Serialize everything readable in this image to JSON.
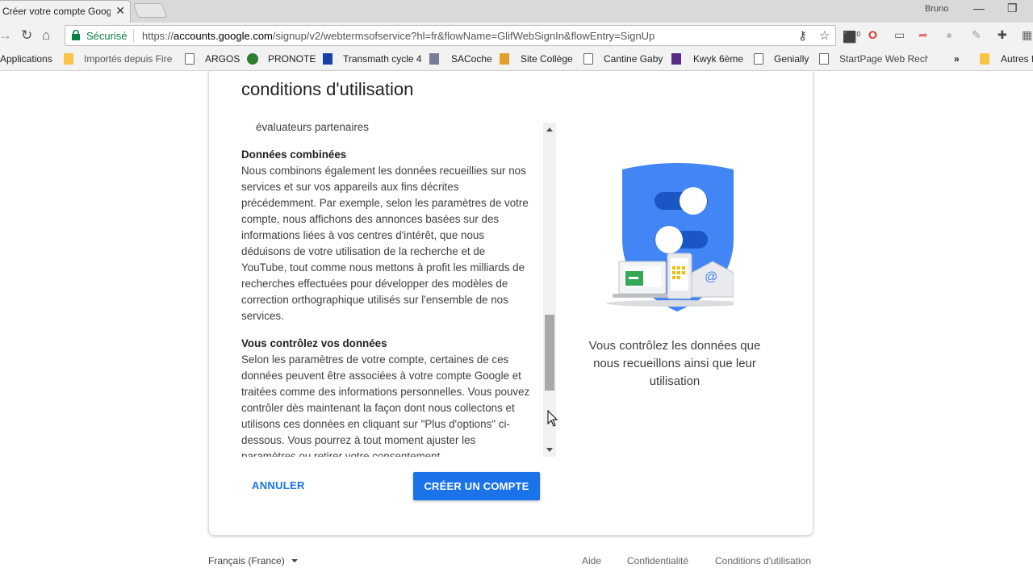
{
  "browser": {
    "tab_title": "Créer votre compte Google",
    "user": "Bruno",
    "secure_label": "Sécurisé",
    "url_scheme": "https://",
    "url_host": "accounts.google.com",
    "url_path": "/signup/v2/webtermsofservice?hl=fr&flowName=GlifWebSignIn&flowEntry=SignUp",
    "bookmarks": [
      "Applications",
      "Importés depuis Fire",
      "ARGOS",
      "PRONOTE",
      "Transmath cycle 4",
      "SACoche",
      "Site Collège",
      "Cantine Gaby",
      "Kwyk 6ème",
      "Genially",
      "StartPage Web Rech",
      "Autres f"
    ],
    "ext_badge": "0"
  },
  "card": {
    "title": "conditions d'utilisation",
    "clipped_text": "évaluateurs partenaires",
    "sections": [
      {
        "heading": "Données combinées",
        "body": "Nous combinons également les données recueillies sur nos services et sur vos appareils aux fins décrites précédemment. Par exemple, selon les paramètres de votre compte, nous affichons des annonces basées sur des informations liées à vos centres d'intérêt, que nous déduisons de votre utilisation de la recherche et de YouTube, tout comme nous mettons à profit les milliards de recherches effectuées pour développer des modèles de correction orthographique utilisés sur l'ensemble de nos services."
      },
      {
        "heading": "Vous contrôlez vos données",
        "body": "Selon les paramètres de votre compte, certaines de ces données peuvent être associées à votre compte Google et traitées comme des informations personnelles. Vous pouvez contrôler dès maintenant la façon dont nous collectons et utilisons ces données en cliquant sur \"Plus d'options\" ci-dessous. Vous pourrez à tout moment ajuster les paramètres ou retirer votre consentement"
      }
    ],
    "side_caption": "Vous contrôlez les données que nous recueillons ainsi que leur utilisation",
    "cancel_label": "ANNULER",
    "create_label": "CRÉER UN COMPTE"
  },
  "footer": {
    "language": "Français (France)",
    "links": [
      "Aide",
      "Confidentialité",
      "Conditions d'utilisation"
    ]
  },
  "colors": {
    "accent": "#1a73e8",
    "secure_green": "#0b8043",
    "shield_blue": "#4285f4"
  }
}
